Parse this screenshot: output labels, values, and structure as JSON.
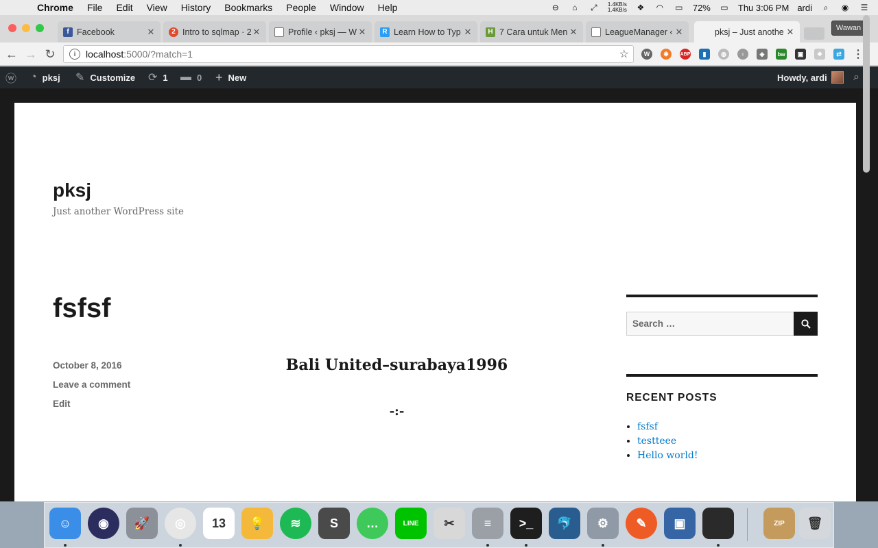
{
  "menubar": {
    "app": "Chrome",
    "items": [
      "File",
      "Edit",
      "View",
      "History",
      "Bookmarks",
      "People",
      "Window",
      "Help"
    ],
    "net_up": "1.4KB/s",
    "net_down": "1.4KB/s",
    "battery": "72%",
    "clock": "Thu 3:06 PM",
    "user": "ardi"
  },
  "tabs": [
    {
      "title": "Facebook",
      "color": "#3b5998",
      "glyph": "f"
    },
    {
      "title": "Intro to sqlmap · 2",
      "color": "#e04a2b",
      "glyph": "2"
    },
    {
      "title": "Profile ‹ pksj — W",
      "color": "#ffffff",
      "glyph": ""
    },
    {
      "title": "Learn How to Typ",
      "color": "#2a9df4",
      "glyph": "R"
    },
    {
      "title": "7 Cara untuk Men",
      "color": "#6a9a3a",
      "glyph": "H"
    },
    {
      "title": "LeagueManager ‹",
      "color": "#ffffff",
      "glyph": ""
    },
    {
      "title": "pksj – Just anothe",
      "color": "#ffffff",
      "glyph": ""
    }
  ],
  "profile_button": "Wawan",
  "address": {
    "host": "localhost",
    "path": ":5000/?match=1"
  },
  "adminbar": {
    "site": "pksj",
    "customize": "Customize",
    "updates": "1",
    "comments": "0",
    "new": "New",
    "howdy": "Howdy, ardi"
  },
  "site": {
    "title": "pksj",
    "description": "Just another WordPress site"
  },
  "post": {
    "title": "fsfsf",
    "date": "October 8, 2016",
    "comment_link": "Leave a comment",
    "edit_link": "Edit",
    "match_title": "Bali United–surabaya1996",
    "match_score": "-:-"
  },
  "sidebar": {
    "search_placeholder": "Search …",
    "recent_title": "RECENT POSTS",
    "recent_posts": [
      "fsfsf",
      "testteee",
      "Hello world!"
    ]
  },
  "dock": [
    {
      "name": "finder-icon",
      "color": "#3b8ee8",
      "glyph": "☺"
    },
    {
      "name": "siri-icon",
      "color": "#2b2d5e",
      "glyph": "◉"
    },
    {
      "name": "launchpad-icon",
      "color": "#8c9098",
      "glyph": "🚀"
    },
    {
      "name": "chrome-icon",
      "color": "#e6e6e6",
      "glyph": "◎"
    },
    {
      "name": "calendar-icon",
      "color": "#ffffff",
      "glyph": "13"
    },
    {
      "name": "lightbulb-icon",
      "color": "#f4b93a",
      "glyph": "💡"
    },
    {
      "name": "spotify-icon",
      "color": "#1db954",
      "glyph": "≋"
    },
    {
      "name": "sublime-icon",
      "color": "#4a4a4a",
      "glyph": "S"
    },
    {
      "name": "whatsapp-icon",
      "color": "#3ec95a",
      "glyph": "…"
    },
    {
      "name": "line-icon",
      "color": "#00c300",
      "glyph": "LINE"
    },
    {
      "name": "scissors-icon",
      "color": "#d8d8d8",
      "glyph": "✂"
    },
    {
      "name": "database-icon",
      "color": "#9aa0a6",
      "glyph": "≡"
    },
    {
      "name": "terminal-icon",
      "color": "#1e1e1e",
      "glyph": ">_"
    },
    {
      "name": "mysql-workbench-icon",
      "color": "#2a5d8f",
      "glyph": "🐬"
    },
    {
      "name": "system-preferences-icon",
      "color": "#8f9aa6",
      "glyph": "⚙"
    },
    {
      "name": "postman-icon",
      "color": "#ef5b25",
      "glyph": "✎"
    },
    {
      "name": "virtualbox-icon",
      "color": "#3565a5",
      "glyph": "▣"
    },
    {
      "name": "console-icon",
      "color": "#2a2a2a",
      "glyph": ""
    },
    {
      "name": "archive-icon",
      "color": "#c59b5d",
      "glyph": "ZIP"
    },
    {
      "name": "trash-icon",
      "color": "#d4d8dc",
      "glyph": "🗑"
    }
  ]
}
